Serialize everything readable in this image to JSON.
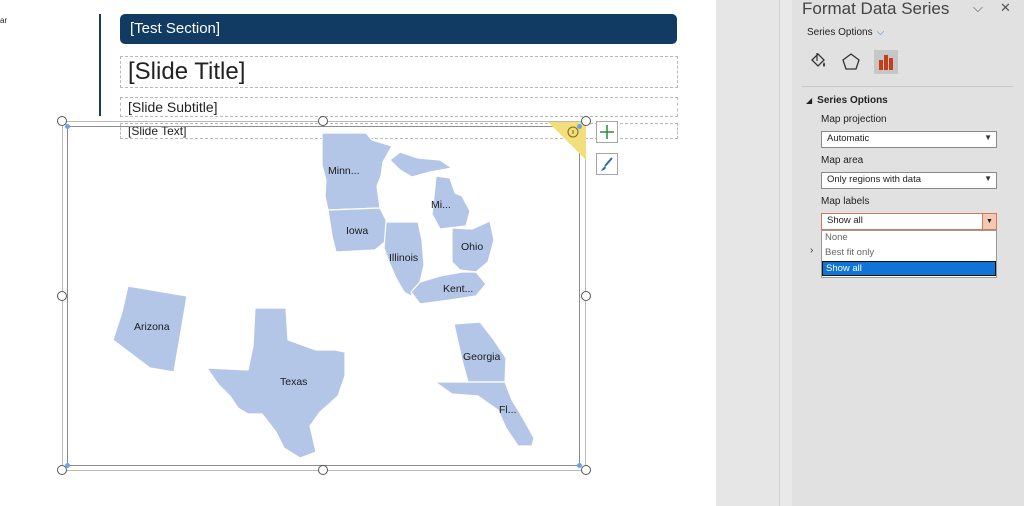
{
  "slide": {
    "edge_text": "ar",
    "section_label": "[Test Section]",
    "title": "[Slide Title]",
    "subtitle": "[Slide Subtitle]",
    "text": "[Slide Text]"
  },
  "map": {
    "labels": {
      "minnesota": "Minn...",
      "michigan": "Mi...",
      "iowa": "Iowa",
      "illinois": "Illinois",
      "ohio": "Ohio",
      "kentucky": "Kent...",
      "arizona": "Arizona",
      "texas": "Texas",
      "georgia": "Georgia",
      "florida": "Fl..."
    },
    "fill_color": "#b4c6e7"
  },
  "chart_buttons": {
    "add": "plus-icon",
    "style": "brush-icon"
  },
  "pane": {
    "title": "Format Data Series",
    "series_options_dropdown": "Series Options",
    "tabs": [
      "fill-bucket-icon",
      "pentagon-icon",
      "bar-chart-icon"
    ],
    "section_title": "Series Options",
    "map_projection": {
      "label": "Map projection",
      "value": "Automatic"
    },
    "map_area": {
      "label": "Map area",
      "value": "Only regions with data"
    },
    "map_labels": {
      "label": "Map labels",
      "value": "Show all",
      "options": [
        "None",
        "Best fit only",
        "Show all"
      ]
    },
    "accent_color": "#c43e1c"
  }
}
